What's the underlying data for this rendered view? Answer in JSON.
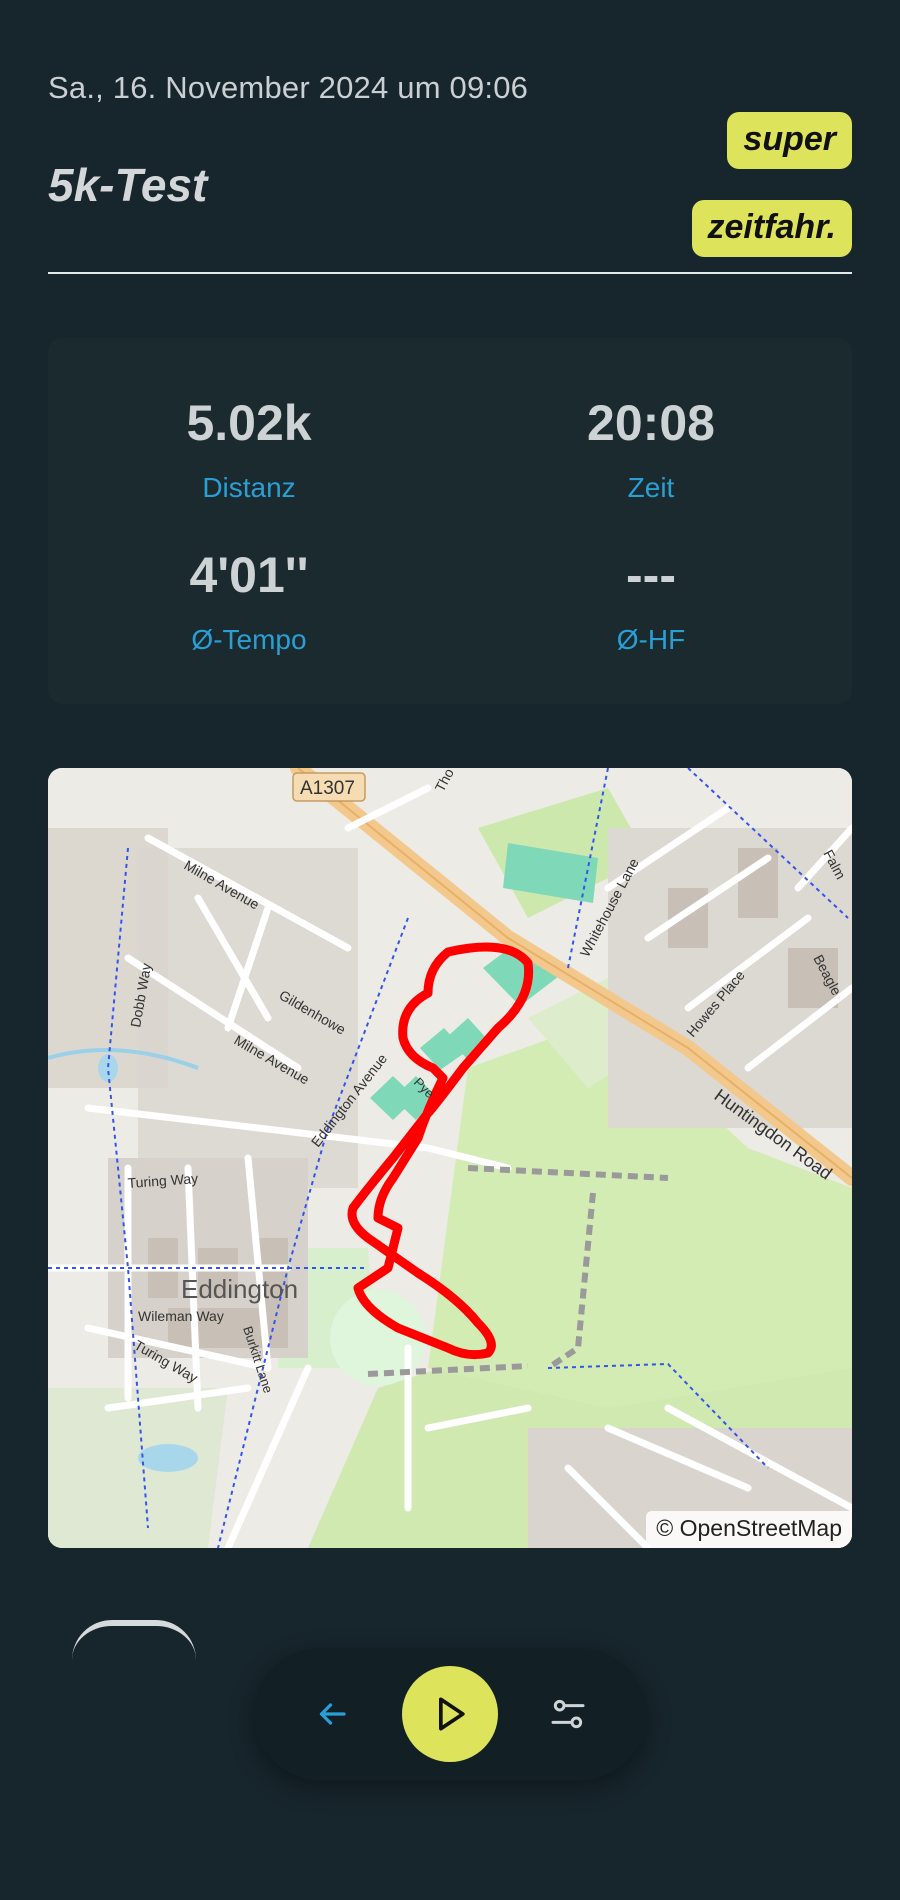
{
  "header": {
    "date": "Sa., 16. November 2024 um 09:06",
    "title": "5k-Test",
    "badges": [
      "super",
      "zeitfahr."
    ]
  },
  "stats": [
    {
      "value": "5.02k",
      "label": "Distanz"
    },
    {
      "value": "20:08",
      "label": "Zeit"
    },
    {
      "value": "4'01''",
      "label": "Ø-Tempo"
    },
    {
      "value": "---",
      "label": "Ø-HF"
    }
  ],
  "map": {
    "attribution": "© OpenStreetMap",
    "labels": {
      "road_number": "A1307",
      "eddington": "Eddington",
      "huntingdon_road": "Huntingdon Road",
      "whitehouse_lane": "Whitehouse Lane",
      "milne_avenue_1": "Milne Avenue",
      "milne_avenue_2": "Milne Avenue",
      "gildenhowe": "Gildenhowe",
      "eddington_avenue": "Eddington Avenue",
      "dobb_way": "Dobb Way",
      "turing_way_1": "Turing Way",
      "turing_way_2": "Turing Way",
      "wileman_way": "Wileman Way",
      "burkitt_lane": "Burkitt Lane",
      "howes_place": "Howes Place",
      "beagle": "Beagle",
      "falmouth": "Falm",
      "thornton": "Tho",
      "pye": "Pye"
    },
    "route_color": "#ff0000"
  },
  "nav": {
    "back_icon": "arrow-left-icon",
    "play_icon": "play-icon",
    "settings_icon": "sliders-icon"
  },
  "colors": {
    "background": "#17252c",
    "accent": "#dde35a",
    "link": "#2a9fd6"
  }
}
